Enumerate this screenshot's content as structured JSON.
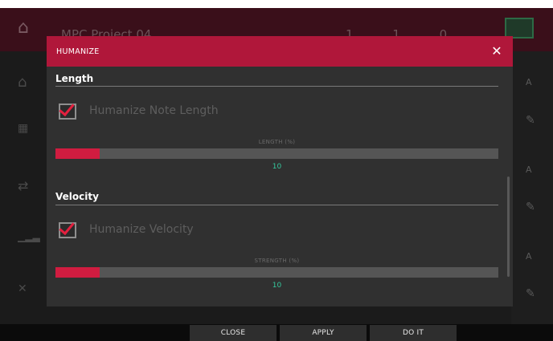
{
  "background": {
    "project_name": "MPC Project 04",
    "time_display": "1 1 0",
    "right_column_labels": [
      "A",
      "A",
      "A"
    ]
  },
  "dialog": {
    "title": "HUMANIZE",
    "close_icon": "close-icon",
    "sections": [
      {
        "title": "Length",
        "checkbox_label": "Humanize Note Length",
        "checked": true,
        "slider_label": "LENGTH (%)",
        "slider_value": "10",
        "slider_fraction": 0.1
      },
      {
        "title": "Velocity",
        "checkbox_label": "Humanize Velocity",
        "checked": true,
        "slider_label": "STRENGTH (%)",
        "slider_value": "10",
        "slider_fraction": 0.1
      }
    ]
  },
  "buttons": {
    "close": "CLOSE",
    "apply": "APPLY",
    "do_it": "DO IT"
  },
  "colors": {
    "accent": "#b0173a",
    "slider_fill": "#d01c40",
    "value_text": "#34c79c",
    "checkmark": "#e3203f"
  }
}
